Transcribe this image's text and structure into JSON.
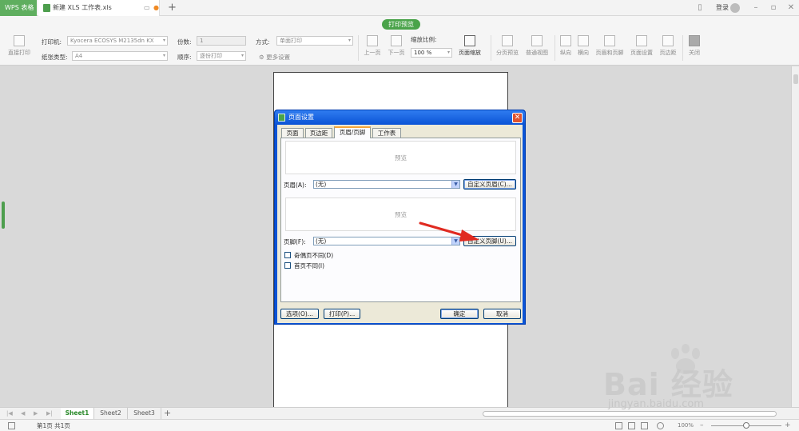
{
  "titlebar": {
    "app_name": "WPS 表格",
    "doc_title": "新建 XLS 工作表.xls",
    "login": "登录"
  },
  "ribbon": {
    "badge": "打印预览",
    "direct_print": "直接打印",
    "printer_label": "打印机:",
    "printer_value": "Kyocera ECOSYS M2135dn KX",
    "paper_label": "纸张类型:",
    "paper_value": "A4",
    "copies_label": "份数:",
    "copies_value": "1",
    "order_label": "顺序:",
    "order_value": "逐份打印",
    "mode_label": "方式:",
    "mode_value": "单面打印",
    "more_settings": "更多设置",
    "prev_page": "上一页",
    "next_page": "下一页",
    "zoom_label": "缩放比例:",
    "zoom_value": "100 %",
    "page_zoom": "页面缩放",
    "page_break_preview": "分页预览",
    "normal_view": "普通视图",
    "portrait": "纵向",
    "landscape": "横向",
    "header_footer": "页眉和页脚",
    "page_setup": "页面设置",
    "margins": "页边距",
    "close": "关闭"
  },
  "dialog": {
    "title": "页面设置",
    "tabs": [
      "页面",
      "页边距",
      "页眉/页脚",
      "工作表"
    ],
    "header_preview": "预览",
    "header_label": "页眉(A):",
    "header_value": "(无)",
    "custom_header": "自定义页眉(C)...",
    "footer_preview": "预览",
    "footer_label": "页脚(F):",
    "footer_value": "(无)",
    "custom_footer": "自定义页脚(U)...",
    "odd_even": "奇偶页不同(D)",
    "first_page": "首页不同(I)",
    "options_btn": "选项(O)...",
    "print_btn": "打印(P)...",
    "ok_btn": "确定",
    "cancel_btn": "取消"
  },
  "sheets": {
    "tabs": [
      "Sheet1",
      "Sheet2",
      "Sheet3"
    ],
    "active": "Sheet1"
  },
  "status": {
    "page_info": "第1页 共1页",
    "zoom": "100%"
  },
  "watermark": {
    "brand": "Bai  经验",
    "url": "jingyan.baidu.com"
  },
  "colors": {
    "accent_green": "#4aa34a",
    "dialog_blue": "#0a53d6",
    "arrow_red": "#e02a20"
  }
}
